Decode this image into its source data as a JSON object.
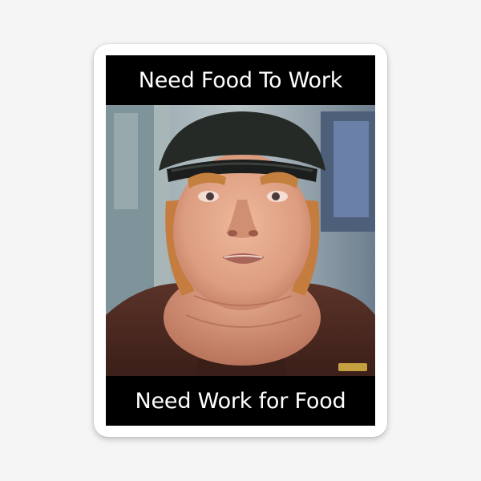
{
  "meme": {
    "top_caption": "Need Food To Work",
    "bottom_caption": "Need Work for Food"
  },
  "photo": {
    "subject": "man-in-cap-and-uniform"
  },
  "colors": {
    "page_background": "#f5f5f5",
    "sticker_border": "#ffffff",
    "caption_background": "#000000",
    "caption_text": "#ffffff",
    "cap": "#2a2d2a",
    "uniform": "#4a2a22",
    "skin": "#e2a487",
    "hair": "#c9803f"
  }
}
